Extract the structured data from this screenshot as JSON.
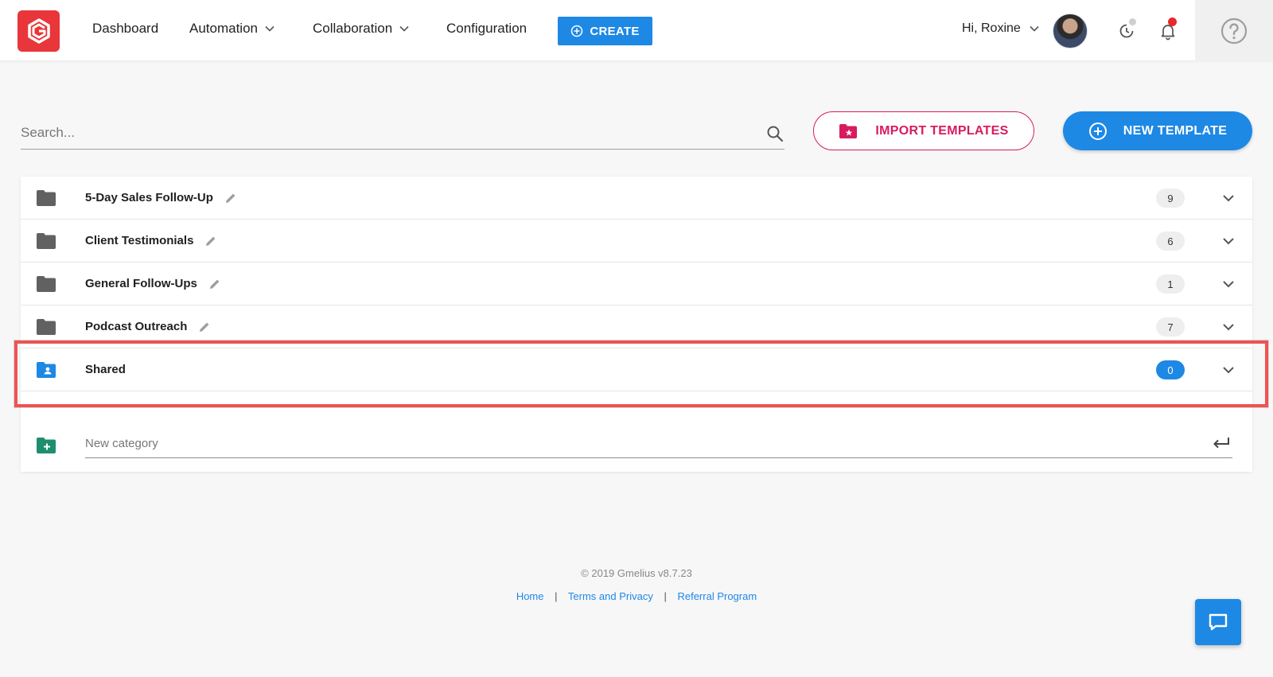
{
  "nav": {
    "dashboard": "Dashboard",
    "automation": "Automation",
    "collaboration": "Collaboration",
    "configuration": "Configuration",
    "create": "CREATE"
  },
  "user": {
    "greeting": "Hi, Roxine"
  },
  "search": {
    "placeholder": "Search..."
  },
  "actions": {
    "import": "IMPORT TEMPLATES",
    "new_template": "NEW TEMPLATE"
  },
  "categories": [
    {
      "name": "5-Day Sales Follow-Up",
      "count": "9"
    },
    {
      "name": "Client Testimonials",
      "count": "6"
    },
    {
      "name": "General Follow-Ups",
      "count": "1"
    },
    {
      "name": "Podcast Outreach",
      "count": "7"
    },
    {
      "name": "Shared",
      "count": "0"
    }
  ],
  "new_category": {
    "placeholder": "New category"
  },
  "footer": {
    "copyright": "© 2019 Gmelius v8.7.23",
    "links": [
      "Home",
      "Terms and Privacy",
      "Referral Program"
    ],
    "separator": "|"
  },
  "colors": {
    "brand_red": "#e8363a",
    "primary_blue": "#1e88e5",
    "import_pink": "#d81b60",
    "highlight_red": "#ef5350",
    "new_category_green": "#1e8f6e"
  },
  "icons": {
    "logo": "gmelius-logo-icon",
    "help": "help-circle-icon",
    "history": "history-icon",
    "notifications": "bell-icon",
    "chat": "chat-bubble-icon"
  }
}
